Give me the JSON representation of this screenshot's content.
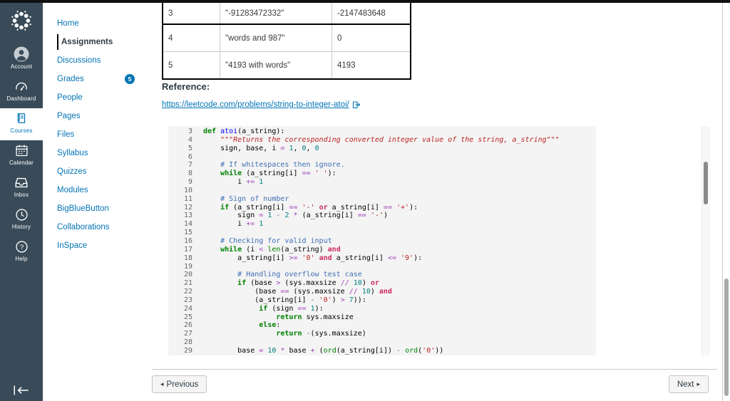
{
  "colors": {
    "sidebar_bg": "#394B58",
    "accent_blue": "#0374B5",
    "active_text": "#2D3B45",
    "code_bg": "#F4F4F4",
    "badge_bg": "#0374B5",
    "keyword": "#008000",
    "string": "#BA2121",
    "comment": "#3E6FB5",
    "number": "#008080"
  },
  "global_nav": {
    "items": [
      {
        "label": "Account",
        "icon": "user"
      },
      {
        "label": "Dashboard",
        "icon": "dashboard"
      },
      {
        "label": "Courses",
        "icon": "book",
        "active": true
      },
      {
        "label": "Calendar",
        "icon": "calendar"
      },
      {
        "label": "Inbox",
        "icon": "inbox"
      },
      {
        "label": "History",
        "icon": "clock"
      },
      {
        "label": "Help",
        "icon": "question"
      }
    ]
  },
  "course_nav": {
    "items": [
      {
        "label": "Home"
      },
      {
        "label": "Assignments",
        "active": true
      },
      {
        "label": "Discussions"
      },
      {
        "label": "Grades",
        "badge": "5"
      },
      {
        "label": "People"
      },
      {
        "label": "Pages"
      },
      {
        "label": "Files"
      },
      {
        "label": "Syllabus"
      },
      {
        "label": "Quizzes"
      },
      {
        "label": "Modules"
      },
      {
        "label": "BigBlueButton"
      },
      {
        "label": "Collaborations"
      },
      {
        "label": "InSpace"
      }
    ]
  },
  "content": {
    "table": {
      "rows": [
        {
          "num": "3",
          "input": "\"-91283472332\"",
          "output": "-2147483648"
        },
        {
          "num": "4",
          "input": "\"words and 987\"",
          "output": "0"
        },
        {
          "num": "5",
          "input": "\"4193 with words\"",
          "output": "4193"
        }
      ]
    },
    "reference_label": "Reference:",
    "reference_link": "https://leetcode.com/problems/string-to-integer-atoi/",
    "code": {
      "lines": [
        {
          "n": 3,
          "t": [
            [
              "k",
              "def"
            ],
            [
              "p",
              " "
            ],
            [
              "fn",
              "atoi"
            ],
            [
              "p",
              "(a_string):"
            ]
          ]
        },
        {
          "n": 4,
          "t": [
            [
              "d",
              "    \"\"\"Returns the corresponding converted integer value of the string, a_string\"\"\""
            ]
          ]
        },
        {
          "n": 5,
          "t": [
            [
              "p",
              "    sign, base, i "
            ],
            [
              "o",
              "="
            ],
            [
              "p",
              " "
            ],
            [
              "n",
              "1"
            ],
            [
              "p",
              ", "
            ],
            [
              "n",
              "0"
            ],
            [
              "p",
              ", "
            ],
            [
              "n",
              "0"
            ]
          ]
        },
        {
          "n": 6,
          "t": []
        },
        {
          "n": 7,
          "t": [
            [
              "c",
              "    # If whitespaces then ignore."
            ]
          ]
        },
        {
          "n": 8,
          "t": [
            [
              "p",
              "    "
            ],
            [
              "k",
              "while"
            ],
            [
              "p",
              " (a_string[i] "
            ],
            [
              "o",
              "=="
            ],
            [
              "p",
              " "
            ],
            [
              "s",
              "' '"
            ],
            [
              "p",
              "):"
            ]
          ]
        },
        {
          "n": 9,
          "t": [
            [
              "p",
              "        i "
            ],
            [
              "o",
              "+="
            ],
            [
              "p",
              " "
            ],
            [
              "n",
              "1"
            ]
          ]
        },
        {
          "n": 10,
          "t": []
        },
        {
          "n": 11,
          "t": [
            [
              "c",
              "    # Sign of number"
            ]
          ]
        },
        {
          "n": 12,
          "t": [
            [
              "p",
              "    "
            ],
            [
              "k",
              "if"
            ],
            [
              "p",
              " (a_string[i] "
            ],
            [
              "o",
              "=="
            ],
            [
              "p",
              " "
            ],
            [
              "s",
              "'-'"
            ],
            [
              "p",
              " "
            ],
            [
              "ow",
              "or"
            ],
            [
              "p",
              " a_string[i] "
            ],
            [
              "o",
              "=="
            ],
            [
              "p",
              " "
            ],
            [
              "s",
              "'+'"
            ],
            [
              "p",
              "):"
            ]
          ]
        },
        {
          "n": 13,
          "t": [
            [
              "p",
              "        sign "
            ],
            [
              "o",
              "="
            ],
            [
              "p",
              " "
            ],
            [
              "n",
              "1"
            ],
            [
              "p",
              " "
            ],
            [
              "o",
              "-"
            ],
            [
              "p",
              " "
            ],
            [
              "n",
              "2"
            ],
            [
              "p",
              " "
            ],
            [
              "o",
              "*"
            ],
            [
              "p",
              " (a_string[i] "
            ],
            [
              "o",
              "=="
            ],
            [
              "p",
              " "
            ],
            [
              "s",
              "'-'"
            ],
            [
              "p",
              ")"
            ]
          ]
        },
        {
          "n": 14,
          "t": [
            [
              "p",
              "        i "
            ],
            [
              "o",
              "+="
            ],
            [
              "p",
              " "
            ],
            [
              "n",
              "1"
            ]
          ]
        },
        {
          "n": 15,
          "t": []
        },
        {
          "n": 16,
          "t": [
            [
              "c",
              "    # Checking for valid input"
            ]
          ]
        },
        {
          "n": 17,
          "t": [
            [
              "p",
              "    "
            ],
            [
              "k",
              "while"
            ],
            [
              "p",
              " (i "
            ],
            [
              "o",
              "<"
            ],
            [
              "p",
              " "
            ],
            [
              "b",
              "len"
            ],
            [
              "p",
              "(a_string) "
            ],
            [
              "ow",
              "and"
            ]
          ]
        },
        {
          "n": 18,
          "t": [
            [
              "p",
              "        a_string[i] "
            ],
            [
              "o",
              ">="
            ],
            [
              "p",
              " "
            ],
            [
              "s",
              "'0'"
            ],
            [
              "p",
              " "
            ],
            [
              "ow",
              "and"
            ],
            [
              "p",
              " a_string[i] "
            ],
            [
              "o",
              "<="
            ],
            [
              "p",
              " "
            ],
            [
              "s",
              "'9'"
            ],
            [
              "p",
              "):"
            ]
          ]
        },
        {
          "n": 19,
          "t": []
        },
        {
          "n": 20,
          "t": [
            [
              "c",
              "        # Handling overflow test case"
            ]
          ]
        },
        {
          "n": 21,
          "t": [
            [
              "p",
              "        "
            ],
            [
              "k",
              "if"
            ],
            [
              "p",
              " (base "
            ],
            [
              "o",
              ">"
            ],
            [
              "p",
              " (sys.maxsize "
            ],
            [
              "o",
              "//"
            ],
            [
              "p",
              " "
            ],
            [
              "n",
              "10"
            ],
            [
              "p",
              ") "
            ],
            [
              "ow",
              "or"
            ]
          ]
        },
        {
          "n": 22,
          "t": [
            [
              "p",
              "            (base "
            ],
            [
              "o",
              "=="
            ],
            [
              "p",
              " (sys.maxsize "
            ],
            [
              "o",
              "//"
            ],
            [
              "p",
              " "
            ],
            [
              "n",
              "10"
            ],
            [
              "p",
              ") "
            ],
            [
              "ow",
              "and"
            ]
          ]
        },
        {
          "n": 23,
          "t": [
            [
              "p",
              "            (a_string[i] "
            ],
            [
              "o",
              "-"
            ],
            [
              "p",
              " "
            ],
            [
              "s",
              "'0'"
            ],
            [
              "p",
              ") "
            ],
            [
              "o",
              ">"
            ],
            [
              "p",
              " "
            ],
            [
              "n",
              "7"
            ],
            [
              "p",
              ")):"
            ]
          ]
        },
        {
          "n": 24,
          "t": [
            [
              "p",
              "             "
            ],
            [
              "k",
              "if"
            ],
            [
              "p",
              " (sign "
            ],
            [
              "o",
              "=="
            ],
            [
              "p",
              " "
            ],
            [
              "n",
              "1"
            ],
            [
              "p",
              "):"
            ]
          ]
        },
        {
          "n": 25,
          "t": [
            [
              "p",
              "                 "
            ],
            [
              "k",
              "return"
            ],
            [
              "p",
              " sys.maxsize"
            ]
          ]
        },
        {
          "n": 26,
          "t": [
            [
              "p",
              "             "
            ],
            [
              "k",
              "else"
            ],
            [
              "p",
              ":"
            ]
          ]
        },
        {
          "n": 27,
          "t": [
            [
              "p",
              "                 "
            ],
            [
              "k",
              "return"
            ],
            [
              "p",
              " "
            ],
            [
              "o",
              "-"
            ],
            [
              "p",
              "(sys.maxsize)"
            ]
          ]
        },
        {
          "n": 28,
          "t": []
        },
        {
          "n": 29,
          "t": [
            [
              "p",
              "        base "
            ],
            [
              "o",
              "="
            ],
            [
              "p",
              " "
            ],
            [
              "n",
              "10"
            ],
            [
              "p",
              " "
            ],
            [
              "o",
              "*"
            ],
            [
              "p",
              " base "
            ],
            [
              "o",
              "+"
            ],
            [
              "p",
              " ("
            ],
            [
              "b",
              "ord"
            ],
            [
              "p",
              "(a_string[i]) "
            ],
            [
              "o",
              "-"
            ],
            [
              "p",
              " "
            ],
            [
              "b",
              "ord"
            ],
            [
              "p",
              "("
            ],
            [
              "s",
              "'0'"
            ],
            [
              "p",
              "))"
            ]
          ]
        }
      ]
    },
    "pagination": {
      "prev_arrow": "◂",
      "previous": "Previous",
      "next": "Next",
      "next_arrow": "▸"
    }
  }
}
